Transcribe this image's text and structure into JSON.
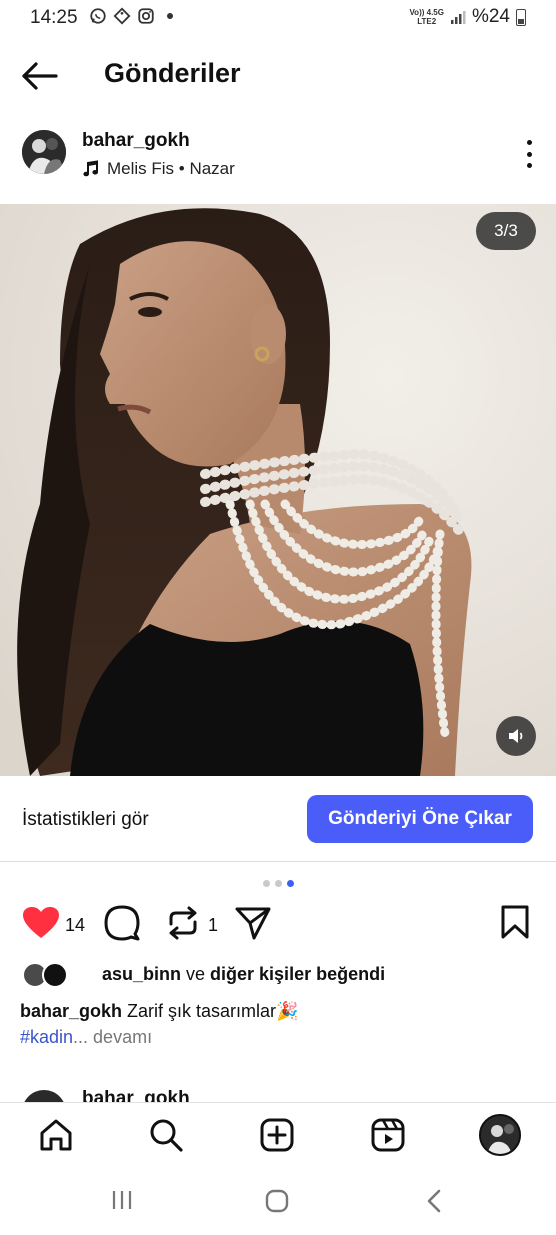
{
  "status_bar": {
    "time": "14:25",
    "network_top": "Vo)) 4.5G",
    "network_bottom": "LTE2",
    "battery": "%24"
  },
  "header": {
    "title": "Gönderiler"
  },
  "post": {
    "username": "bahar_gokh",
    "music": "Melis Fis • Nazar",
    "image_counter": "3/3",
    "stats_link": "İstatistikleri gör",
    "boost_button": "Gönderiyi Öne Çıkar",
    "carousel": {
      "total": 3,
      "active_index": 3
    },
    "like_count": "14",
    "repost_count": "1",
    "likes_user": "asu_binn",
    "likes_connector": " ve ",
    "likes_others": "diğer kişiler beğendi",
    "caption_user": "bahar_gokh",
    "caption_text": " Zarif şık tasarımlar🎉",
    "caption_hashtag": "#kadin",
    "caption_more": "... devamı"
  },
  "next_post": {
    "username": "bahar_gokh"
  },
  "colors": {
    "accent": "#4a5df9",
    "like": "#ff3040",
    "hashtag": "#3a55c8",
    "dot_active": "#3f5ef2"
  },
  "icons": {
    "back": "arrow-left-icon",
    "music": "music-note-icon",
    "more": "more-vertical-icon",
    "sound": "speaker-icon",
    "like": "heart-filled-icon",
    "comment": "comment-icon",
    "repost": "repost-icon",
    "share": "send-icon",
    "save": "bookmark-icon",
    "nav_home": "home-icon",
    "nav_search": "search-icon",
    "nav_create": "plus-square-icon",
    "nav_reels": "reels-icon",
    "sys_recent": "recent-apps-icon",
    "sys_home": "system-home-icon",
    "sys_back": "system-back-icon"
  }
}
